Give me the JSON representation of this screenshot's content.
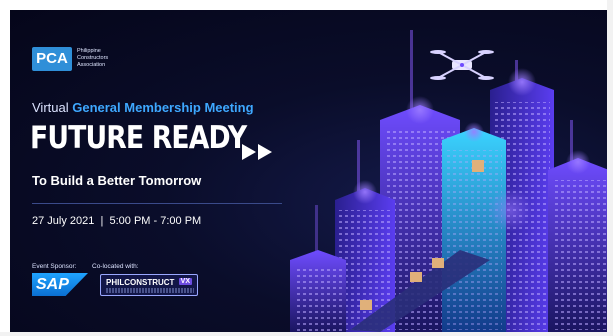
{
  "organization": {
    "logo_text": "PCA",
    "name_lines": [
      "Philippine",
      "Constructors",
      "Association"
    ]
  },
  "event": {
    "prefix": "Virtual ",
    "name": "General Membership Meeting",
    "headline": "FUTURE READY",
    "tagline": "To Build a Better Tomorrow",
    "date": "27 July 2021",
    "separator": "|",
    "time": "5:00 PM - 7:00 PM"
  },
  "sponsors": {
    "sponsor_label": "Event Sponsor:",
    "colocated_label": "Co-located with:",
    "sponsor_logo_text": "SAP",
    "colocated_logo_text": "PHILCONSTRUCT",
    "colocated_logo_badge": "VX"
  },
  "colors": {
    "background": "#0a0d2a",
    "accent_blue": "#3ea8ff",
    "logo_blue": "#2f8fd8",
    "neon_purple": "#8a5cff",
    "neon_cyan": "#34d6ff"
  },
  "icons": [
    "fast-forward-icon",
    "drone-icon",
    "city-illustration"
  ]
}
